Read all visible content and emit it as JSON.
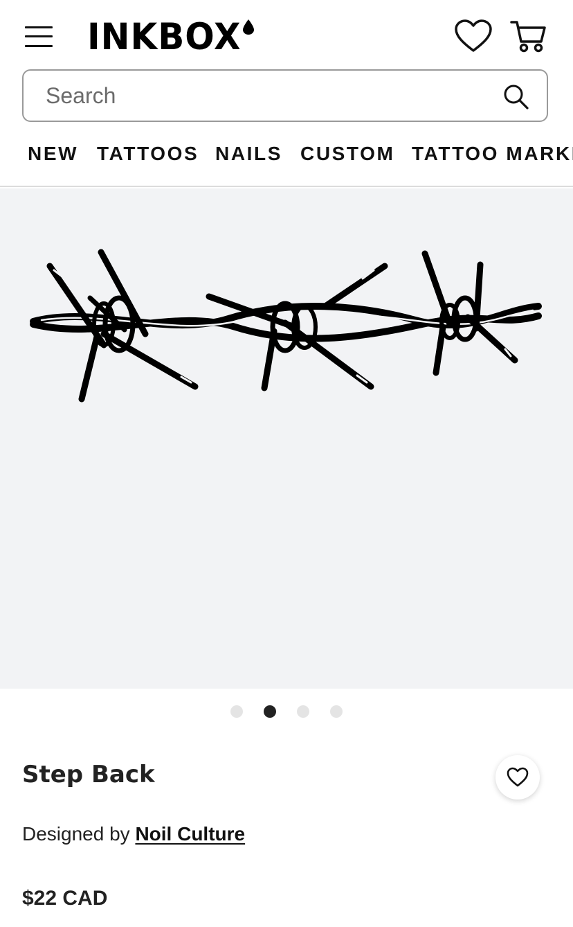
{
  "header": {
    "logo_text": "INKBOX",
    "menu_icon": "hamburger-menu-icon",
    "wishlist_icon": "heart-outline-icon",
    "cart_icon": "shopping-cart-icon"
  },
  "search": {
    "placeholder": "Search",
    "value": "",
    "icon": "search-icon"
  },
  "nav": {
    "items": [
      {
        "label": "NEW"
      },
      {
        "label": "TATTOOS"
      },
      {
        "label": "NAILS"
      },
      {
        "label": "CUSTOM"
      },
      {
        "label": "TATTOO MARKETPLACE"
      }
    ]
  },
  "gallery": {
    "image_count": 4,
    "active_index": 1,
    "image_icon": "barbed-wire-tattoo-design"
  },
  "product": {
    "title": "Step Back",
    "designed_by_label": "Designed by",
    "designer_name": "Noil Culture",
    "price": "$22 CAD",
    "favorite_icon": "heart-outline-icon"
  },
  "colors": {
    "text": "#111111",
    "gallery_bg": "#f2f3f5",
    "dot_active": "#222222",
    "dot_inactive": "#e4e4e4",
    "search_border": "#9a9a9a"
  }
}
